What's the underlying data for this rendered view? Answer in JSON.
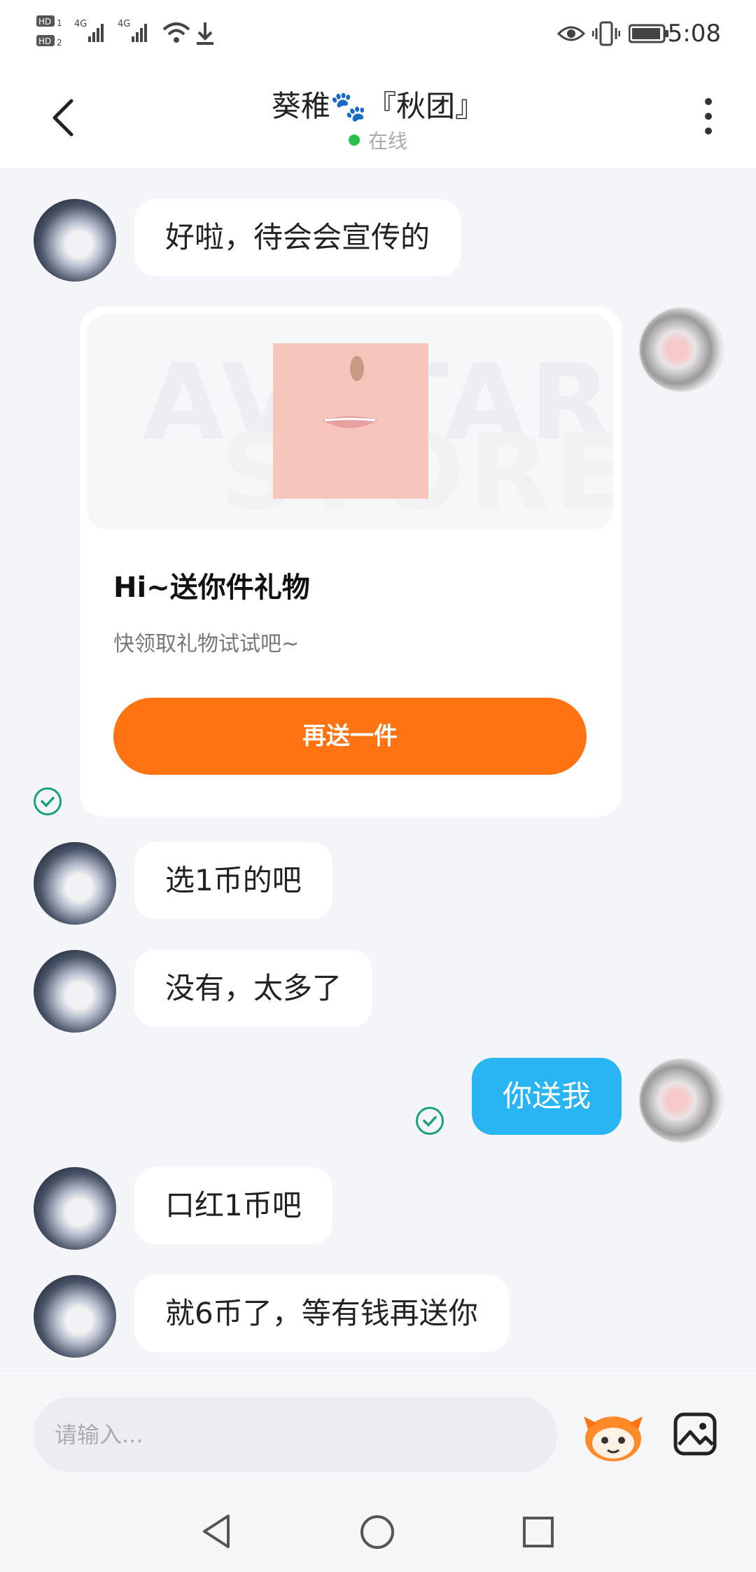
{
  "status_bar": {
    "left_indicators": "HD₁ 4G 4G",
    "time": "5:08"
  },
  "header": {
    "title": "葵稚🐾『秋团』",
    "status": "在线"
  },
  "messages": [
    {
      "side": "left",
      "text": "好啦，待会会宣传的"
    },
    {
      "side": "right",
      "type": "gift_card",
      "card_title": "Hi~送你件礼物",
      "card_subtitle": "快领取礼物试试吧~",
      "button_label": "再送一件",
      "watermark_line1": "AVATAR",
      "watermark_line2": "STORE"
    },
    {
      "side": "left",
      "text": "选1币的吧"
    },
    {
      "side": "left",
      "text": "没有，太多了"
    },
    {
      "side": "right",
      "text": "你送我"
    },
    {
      "side": "left",
      "text": "口红1币吧"
    },
    {
      "side": "left",
      "text": "就6币了，等有钱再送你"
    }
  ],
  "input": {
    "placeholder": "请输入..."
  },
  "icons": {
    "back": "back-arrow-icon",
    "more": "more-vertical-icon",
    "emoji": "mascot-emoji-icon",
    "image": "image-picker-icon",
    "sent": "check-circle-icon"
  },
  "colors": {
    "accent_orange": "#ff7313",
    "my_bubble": "#29b5f3",
    "online_dot": "#27c24c",
    "check_green": "#1aa07a"
  }
}
